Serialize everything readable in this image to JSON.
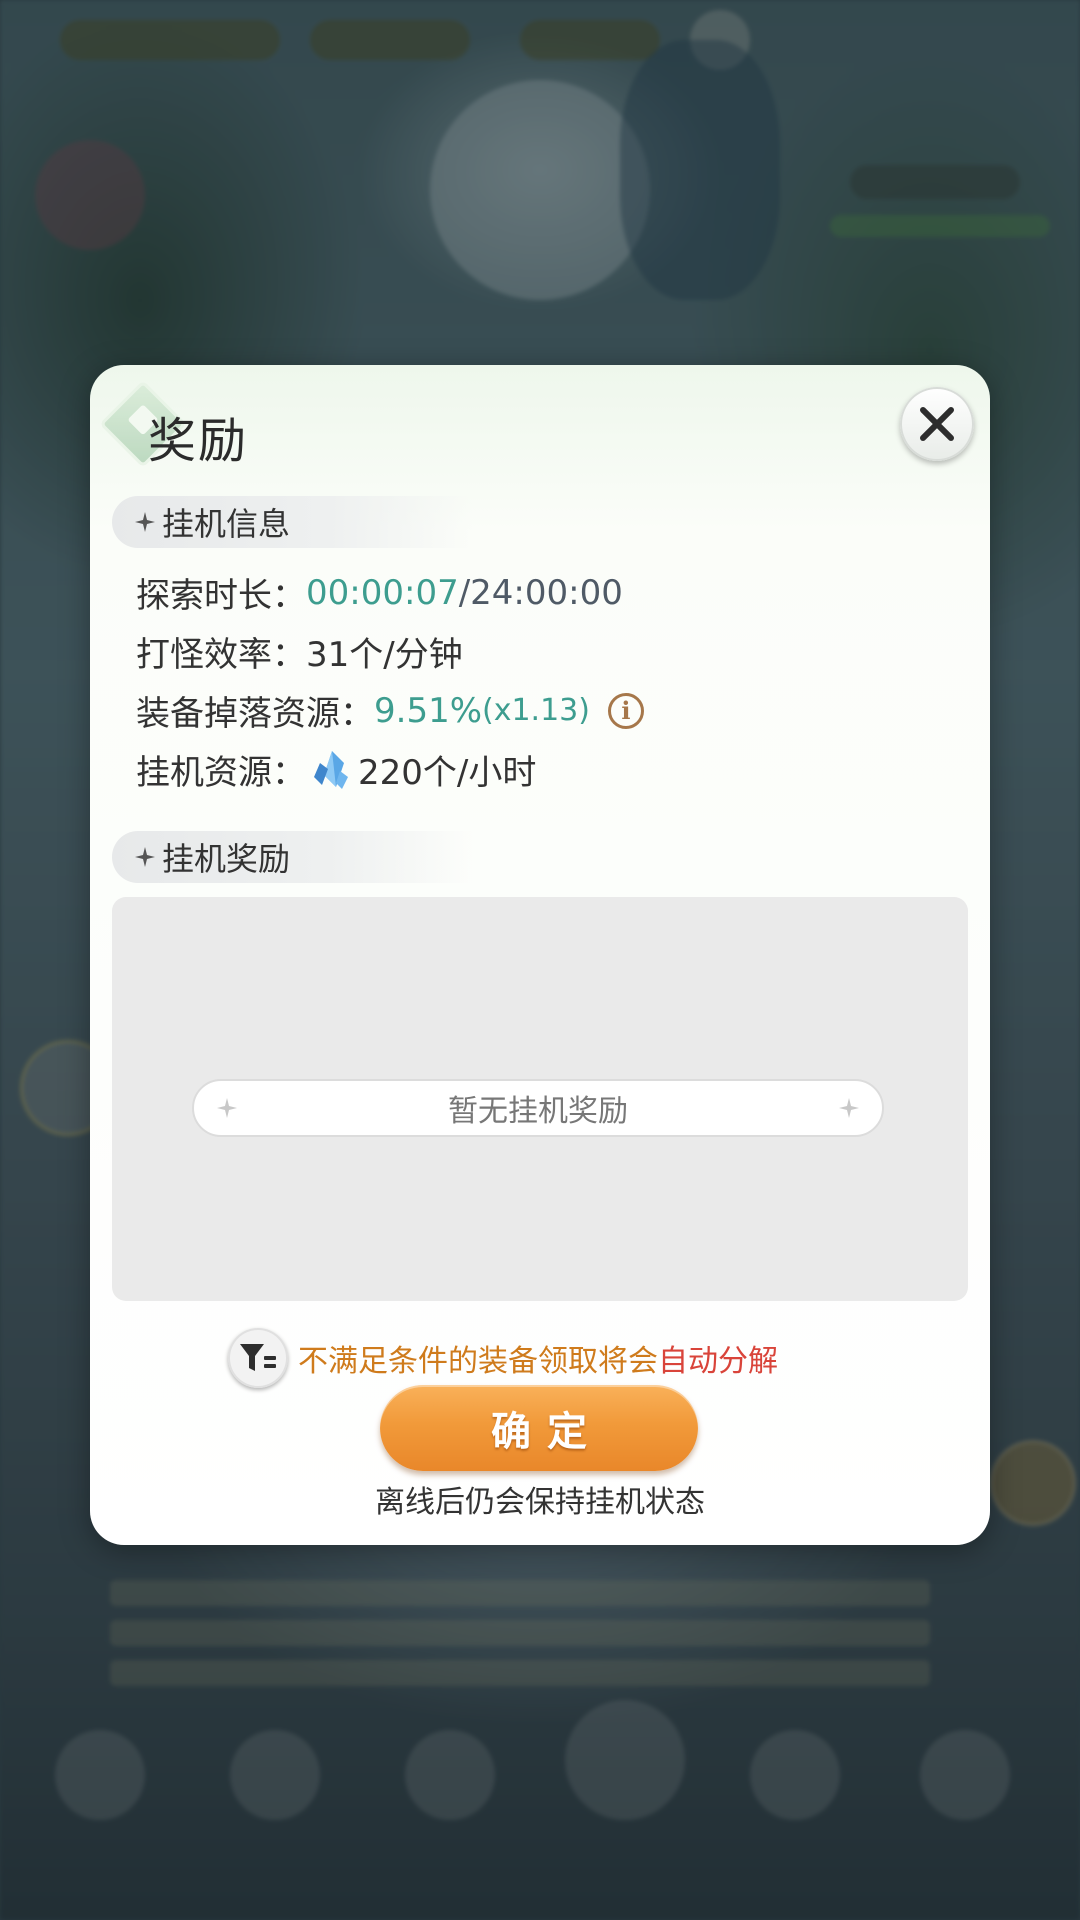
{
  "dialog": {
    "title": "奖励",
    "close_icon": "close-icon"
  },
  "idle_info": {
    "header": "挂机信息",
    "explore_duration": {
      "label": "探索时长：",
      "current": "00:00:07",
      "separator": "/",
      "max": "24:00:00"
    },
    "kill_rate": {
      "label": "打怪效率：",
      "value": "31个/分钟"
    },
    "equip_drop": {
      "label": "装备掉落资源：",
      "percent": "9.51%",
      "multiplier": "(x1.13)",
      "info_icon": "info-icon"
    },
    "idle_resource": {
      "label": "挂机资源：",
      "icon": "blue-crystal-icon",
      "value": "220个/小时"
    }
  },
  "idle_rewards": {
    "header": "挂机奖励",
    "empty_text": "暂无挂机奖励"
  },
  "notice": {
    "icon": "filter-icon",
    "text": "不满足条件的装备领取将会",
    "emphasis": "自动分解"
  },
  "confirm_button": {
    "label": "确定"
  },
  "footnote": "离线后仍会保持挂机状态",
  "colors": {
    "accent_teal": "#3d9d8f",
    "notice_orange": "#cf7b1c",
    "notice_red": "#d9443a",
    "button_orange": "#f19a3a"
  }
}
